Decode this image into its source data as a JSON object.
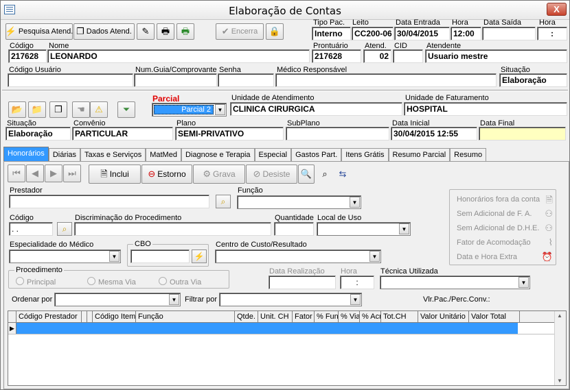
{
  "window": {
    "title": "Elaboração de Contas",
    "close_label": "X"
  },
  "toolbar": {
    "search_label": "Pesquisa Atend.",
    "details_label": "Dados Atend.",
    "close_account_label": "Encerra"
  },
  "header": {
    "tipo_pac": {
      "label": "Tipo Pac.",
      "value": "Interno"
    },
    "leito": {
      "label": "Leito",
      "value": "CC200-06"
    },
    "data_entrada": {
      "label": "Data Entrada",
      "value": "30/04/2015"
    },
    "hora_entrada": {
      "label": "Hora",
      "value": "12:00"
    },
    "data_saida": {
      "label": "Data Saída",
      "value": ""
    },
    "hora_saida": {
      "label": "Hora",
      "value": ":"
    },
    "codigo": {
      "label": "Código",
      "value": "217628"
    },
    "nome": {
      "label": "Nome",
      "value": "LEONARDO"
    },
    "prontuario": {
      "label": "Prontuário",
      "value": "217628"
    },
    "atend": {
      "label": "Atend.",
      "value": "02"
    },
    "cid": {
      "label": "CID",
      "value": ""
    },
    "atendente": {
      "label": "Atendente",
      "value": "Usuario mestre"
    },
    "codigo_usuario": {
      "label": "Código Usuário",
      "value": ""
    },
    "num_guia": {
      "label": "Num.Guia/Comprovante",
      "value": ""
    },
    "senha": {
      "label": "Senha",
      "value": ""
    },
    "medico": {
      "label": "Médico Responsável",
      "value": ""
    },
    "situacao": {
      "label": "Situação",
      "value": "Elaboração"
    }
  },
  "account": {
    "parcial": {
      "label": "Parcial",
      "value": "Parcial 2"
    },
    "unidade_atendimento": {
      "label": "Unidade de Atendimento",
      "value": "CLINICA CIRURGICA"
    },
    "unidade_faturamento": {
      "label": "Unidade de Faturamento",
      "value": "HOSPITAL"
    },
    "situacao": {
      "label": "Situação",
      "value": "Elaboração"
    },
    "convenio": {
      "label": "Convênio",
      "value": "PARTICULAR"
    },
    "plano": {
      "label": "Plano",
      "value": "SEMI-PRIVATIVO"
    },
    "subplano": {
      "label": "SubPlano",
      "value": ""
    },
    "data_inicial": {
      "label": "Data Inicial",
      "value": "30/04/2015 12:55"
    },
    "data_final": {
      "label": "Data Final",
      "value": ""
    }
  },
  "tabs": [
    {
      "label": "Honorários"
    },
    {
      "label": "Diárias"
    },
    {
      "label": "Taxas e Serviços"
    },
    {
      "label": "MatMed"
    },
    {
      "label": "Diagnose e Terapia"
    },
    {
      "label": "Especial"
    },
    {
      "label": "Gastos Part."
    },
    {
      "label": "Itens Grátis"
    },
    {
      "label": "Resumo Parcial"
    },
    {
      "label": "Resumo"
    }
  ],
  "honorarios": {
    "inclui_label": "Inclui",
    "estorno_label": "Estorno",
    "grava_label": "Grava",
    "desiste_label": "Desiste",
    "prestador_label": "Prestador",
    "funcao_label": "Função",
    "codigo_label": "Código",
    "codigo_value": ". .",
    "discriminacao_label": "Discriminação do Procedimento",
    "quantidade_label": "Quantidade",
    "local_uso_label": "Local de Uso",
    "especialidade_label": "Especialidade do Médico",
    "cbo_label": "CBO",
    "centro_custo_label": "Centro de Custo/Resultado",
    "procedimento_label": "Procedimento",
    "radio_principal": "Principal",
    "radio_mesma_via": "Mesma Via",
    "radio_outra_via": "Outra Via",
    "data_realizacao_label": "Data Realização",
    "hora_label": "Hora",
    "hora_value": ":",
    "tecnica_label": "Técnica Utilizada",
    "ordenar_label": "Ordenar por",
    "filtrar_label": "Filtrar por",
    "vlr_label": "Vlr.Pac./Perc.Conv.:",
    "side_options": [
      "Honorários fora da conta",
      "Sem Adicional de F. A.",
      "Sem Adicional de D.H.E.",
      "Fator de Acomodação",
      "Data e Hora Extra"
    ]
  },
  "grid": {
    "columns": [
      "Código Prestador",
      "",
      "",
      "Código Item",
      "Função",
      "Qtde.",
      "Unit. CH",
      "Fator",
      "% Fun",
      "% Via",
      "% Acr",
      "Tot.CH",
      "Valor Unitário",
      "Valor Total"
    ]
  }
}
